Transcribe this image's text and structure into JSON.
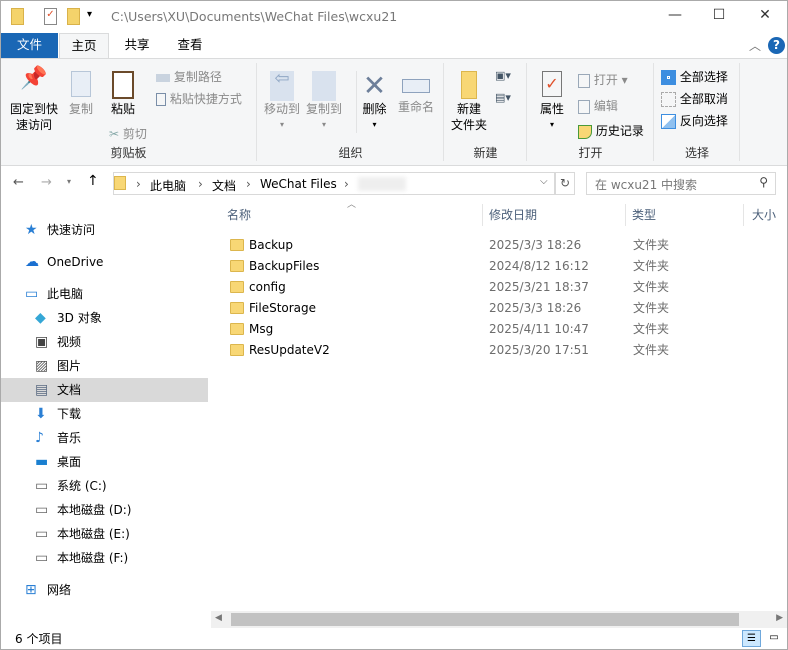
{
  "window": {
    "path": "C:\\Users\\XU\\Documents\\WeChat Files\\wcxu21",
    "minimize": "—",
    "maximize": "☐",
    "close": "✕"
  },
  "tabs": {
    "file": "文件",
    "home": "主页",
    "share": "共享",
    "view": "查看"
  },
  "ribbon": {
    "clipboard": {
      "label": "剪贴板",
      "pin": "固定到快\n速访问",
      "pin1": "固定到快",
      "pin2": "速访问",
      "copy": "复制",
      "paste": "粘贴",
      "copy_path": "复制路径",
      "paste_shortcut": "粘贴快捷方式",
      "cut": "剪切"
    },
    "organize": {
      "label": "组织",
      "move_to": "移动到",
      "copy_to": "复制到",
      "delete": "删除",
      "rename": "重命名"
    },
    "new": {
      "label": "新建",
      "new_folder1": "新建",
      "new_folder2": "文件夹"
    },
    "open": {
      "label": "打开",
      "properties": "属性",
      "open": "打开",
      "edit": "编辑",
      "history": "历史记录"
    },
    "select": {
      "label": "选择",
      "select_all": "全部选择",
      "select_none": "全部取消",
      "invert": "反向选择"
    }
  },
  "address": {
    "crumbs": [
      "此电脑",
      "文档",
      "WeChat Files"
    ],
    "search_placeholder": "在 wcxu21 中搜索"
  },
  "nav": [
    {
      "label": "快速访问",
      "icon": "star-icon"
    },
    {
      "label": "OneDrive",
      "icon": "cloud-icon"
    },
    {
      "label": "此电脑",
      "icon": "computer-icon"
    },
    {
      "label": "3D 对象",
      "icon": "cube-icon"
    },
    {
      "label": "视频",
      "icon": "video-icon"
    },
    {
      "label": "图片",
      "icon": "picture-icon"
    },
    {
      "label": "文档",
      "icon": "document-icon",
      "selected": true
    },
    {
      "label": "下载",
      "icon": "download-icon"
    },
    {
      "label": "音乐",
      "icon": "music-icon"
    },
    {
      "label": "桌面",
      "icon": "desktop-icon"
    },
    {
      "label": "系统 (C:)",
      "icon": "drive-icon"
    },
    {
      "label": "本地磁盘 (D:)",
      "icon": "drive-icon"
    },
    {
      "label": "本地磁盘 (E:)",
      "icon": "drive-icon"
    },
    {
      "label": "本地磁盘 (F:)",
      "icon": "drive-icon"
    },
    {
      "label": "网络",
      "icon": "network-icon"
    }
  ],
  "columns": {
    "name": "名称",
    "modified": "修改日期",
    "type": "类型",
    "size": "大小"
  },
  "files": [
    {
      "name": "Backup",
      "modified": "2025/3/3 18:26",
      "type": "文件夹"
    },
    {
      "name": "BackupFiles",
      "modified": "2024/8/12 16:12",
      "type": "文件夹"
    },
    {
      "name": "config",
      "modified": "2025/3/21 18:37",
      "type": "文件夹"
    },
    {
      "name": "FileStorage",
      "modified": "2025/3/3 18:26",
      "type": "文件夹"
    },
    {
      "name": "Msg",
      "modified": "2025/4/11 10:47",
      "type": "文件夹"
    },
    {
      "name": "ResUpdateV2",
      "modified": "2025/3/20 17:51",
      "type": "文件夹"
    }
  ],
  "status": {
    "count": "6 个项目"
  },
  "colors": {
    "accent": "#1a67b5",
    "selected": "#d9d9d9"
  }
}
